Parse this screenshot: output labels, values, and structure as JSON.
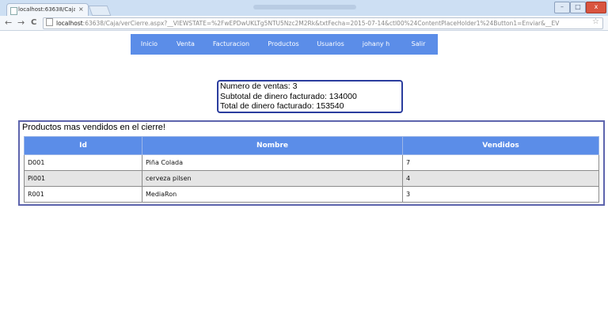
{
  "browser": {
    "tab_title": "localhost:63638/Caja/ver",
    "tab_close": "×",
    "url_host": "localhost",
    "url_rest": ":63638/Caja/verCierre.aspx?__VIEWSTATE=%2FwEPDwUKLTg5NTU5Nzc2M2Rk&txtFecha=2015-07-14&ctl00%24ContentPlaceHolder1%24Button1=Enviar&__EV",
    "back": "←",
    "forward": "→",
    "reload": "C",
    "minimize": "–",
    "maximize": "□",
    "close": "x",
    "star": "☆"
  },
  "menu": {
    "items": [
      {
        "label": "Inicio"
      },
      {
        "label": "Venta"
      },
      {
        "label": "Facturacion"
      },
      {
        "label": "Productos"
      },
      {
        "label": "Usuarios"
      },
      {
        "label": "johany h"
      },
      {
        "label": "Salir"
      }
    ]
  },
  "summary": {
    "ventas": "Numero de ventas: 3",
    "subtotal": "Subtotal de dinero facturado: 134000",
    "total": "Total de dinero facturado: 153540"
  },
  "products": {
    "caption": "Productos mas vendidos en el cierre!",
    "headers": [
      "Id",
      "Nombre",
      "Vendidos"
    ],
    "rows": [
      [
        "D001",
        "Piña Colada",
        "7"
      ],
      [
        "Pi001",
        "cerveza pilsen",
        "4"
      ],
      [
        "R001",
        "MediaRon",
        "3"
      ]
    ]
  },
  "colors": {
    "menu_bg": "#5b8de8",
    "summary_border": "#2b3d9e",
    "grid_border": "#5d64ad",
    "alt_row": "#e5e5e5"
  }
}
